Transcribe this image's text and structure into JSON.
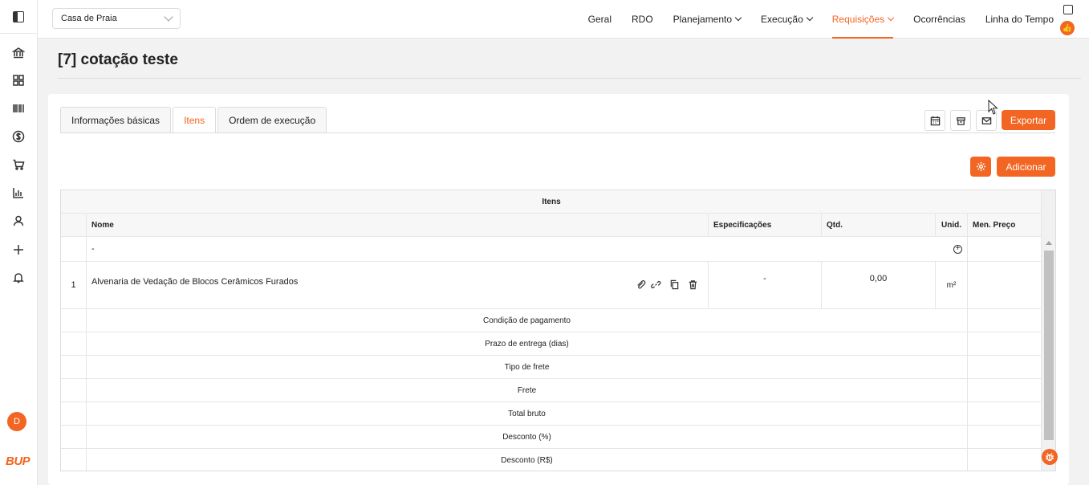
{
  "app": {
    "logo_text": "BUP",
    "user_initial": "D"
  },
  "sidebar": {
    "icons": [
      "panel-toggle-icon",
      "bank-icon",
      "grid-icon",
      "barcode-icon",
      "dollar-icon",
      "cart-icon",
      "bar-chart-icon",
      "user-icon",
      "plus-icon",
      "bell-icon"
    ]
  },
  "topbar": {
    "project": "Casa de Praia",
    "nav": [
      {
        "label": "Geral",
        "dropdown": false,
        "active": false
      },
      {
        "label": "RDO",
        "dropdown": false,
        "active": false
      },
      {
        "label": "Planejamento",
        "dropdown": true,
        "active": false
      },
      {
        "label": "Execução",
        "dropdown": true,
        "active": false
      },
      {
        "label": "Requisições",
        "dropdown": true,
        "active": true
      },
      {
        "label": "Ocorrências",
        "dropdown": false,
        "active": false
      },
      {
        "label": "Linha do Tempo",
        "dropdown": false,
        "active": false
      }
    ]
  },
  "page": {
    "title": "[7] cotação teste"
  },
  "tabs": [
    {
      "label": "Informações básicas",
      "active": false
    },
    {
      "label": "Itens",
      "active": true
    },
    {
      "label": "Ordem de execução",
      "active": false
    }
  ],
  "toolbar": {
    "export_label": "Exportar",
    "add_label": "Adicionar"
  },
  "table": {
    "group_header": "Itens",
    "columns": {
      "name": "Nome",
      "specs": "Especificações",
      "qty": "Qtd.",
      "unit": "Unid.",
      "min_price": "Men. Preço"
    },
    "placeholder_row": {
      "name": "-"
    },
    "items": [
      {
        "index": "1",
        "name": "Alvenaria de Vedação de Blocos Cerâmicos Furados",
        "specs": "-",
        "qty": "0,00",
        "unit": "m²"
      }
    ],
    "summary_rows": [
      "Condição de pagamento",
      "Prazo de entrega (dias)",
      "Tipo de frete",
      "Frete",
      "Total bruto",
      "Desconto (%)",
      "Desconto (R$)"
    ]
  },
  "colors": {
    "accent": "#f26522",
    "border": "#dcdcdc"
  }
}
